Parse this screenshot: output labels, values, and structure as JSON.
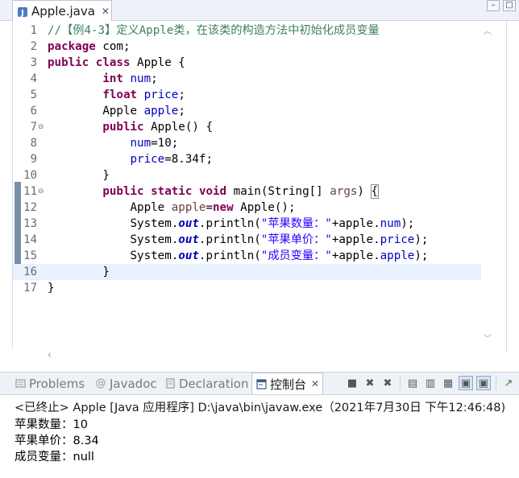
{
  "editor": {
    "tab_label": "Apple.java",
    "close_glyph": "✕",
    "lines": [
      {
        "n": "1",
        "segs": [
          {
            "t": "//【例4-3】定义Apple类，在该类的构造方法中初始化成员变量",
            "c": "cmt"
          }
        ]
      },
      {
        "n": "2",
        "segs": [
          {
            "t": "package",
            "c": "kw"
          },
          {
            "t": " com;"
          }
        ]
      },
      {
        "n": "3",
        "segs": [
          {
            "t": "public",
            "c": "kw"
          },
          {
            "t": " "
          },
          {
            "t": "class",
            "c": "kw"
          },
          {
            "t": " Apple {"
          }
        ]
      },
      {
        "n": "4",
        "segs": [
          {
            "t": "        "
          },
          {
            "t": "int",
            "c": "kw"
          },
          {
            "t": " "
          },
          {
            "t": "num",
            "c": "fld"
          },
          {
            "t": ";"
          }
        ]
      },
      {
        "n": "5",
        "segs": [
          {
            "t": "        "
          },
          {
            "t": "float",
            "c": "kw"
          },
          {
            "t": " "
          },
          {
            "t": "price",
            "c": "fld"
          },
          {
            "t": ";"
          }
        ]
      },
      {
        "n": "6",
        "segs": [
          {
            "t": "        Apple "
          },
          {
            "t": "apple",
            "c": "fld"
          },
          {
            "t": ";"
          }
        ]
      },
      {
        "n": "7",
        "fold": true,
        "segs": [
          {
            "t": "        "
          },
          {
            "t": "public",
            "c": "kw"
          },
          {
            "t": " Apple() {"
          }
        ]
      },
      {
        "n": "8",
        "segs": [
          {
            "t": "            "
          },
          {
            "t": "num",
            "c": "fld"
          },
          {
            "t": "=10;"
          }
        ]
      },
      {
        "n": "9",
        "segs": [
          {
            "t": "            "
          },
          {
            "t": "price",
            "c": "fld"
          },
          {
            "t": "=8.34f;"
          }
        ]
      },
      {
        "n": "10",
        "segs": [
          {
            "t": "        }"
          }
        ]
      },
      {
        "n": "11",
        "fold": true,
        "segs": [
          {
            "t": "        "
          },
          {
            "t": "public",
            "c": "kw"
          },
          {
            "t": " "
          },
          {
            "t": "static",
            "c": "kw"
          },
          {
            "t": " "
          },
          {
            "t": "void",
            "c": "kw"
          },
          {
            "t": " main(String[] "
          },
          {
            "t": "args",
            "c": "var"
          },
          {
            "t": ") "
          },
          {
            "t": "{",
            "c": "brace-hl"
          }
        ]
      },
      {
        "n": "12",
        "segs": [
          {
            "t": "            Apple "
          },
          {
            "t": "apple",
            "c": "var"
          },
          {
            "t": "="
          },
          {
            "t": "new",
            "c": "kw"
          },
          {
            "t": " Apple();"
          }
        ]
      },
      {
        "n": "13",
        "segs": [
          {
            "t": "            System."
          },
          {
            "t": "out",
            "c": "stat"
          },
          {
            "t": ".println("
          },
          {
            "t": "\"苹果数量：\"",
            "c": "str"
          },
          {
            "t": "+apple."
          },
          {
            "t": "num",
            "c": "fld"
          },
          {
            "t": ");"
          }
        ]
      },
      {
        "n": "14",
        "segs": [
          {
            "t": "            System."
          },
          {
            "t": "out",
            "c": "stat"
          },
          {
            "t": ".println("
          },
          {
            "t": "\"苹果单价：\"",
            "c": "str"
          },
          {
            "t": "+apple."
          },
          {
            "t": "price",
            "c": "fld"
          },
          {
            "t": ");"
          }
        ]
      },
      {
        "n": "15",
        "segs": [
          {
            "t": "            System."
          },
          {
            "t": "out",
            "c": "stat"
          },
          {
            "t": ".println("
          },
          {
            "t": "\"成员变量：\"",
            "c": "str"
          },
          {
            "t": "+apple."
          },
          {
            "t": "apple",
            "c": "fld"
          },
          {
            "t": ");"
          }
        ]
      },
      {
        "n": "16",
        "segs": [
          {
            "t": "        }"
          }
        ]
      },
      {
        "n": "17",
        "segs": [
          {
            "t": "}"
          }
        ]
      }
    ]
  },
  "views": {
    "tabs": [
      {
        "label": "Problems",
        "icon": "problems-icon"
      },
      {
        "label": "Javadoc",
        "icon": "javadoc-icon"
      },
      {
        "label": "Declaration",
        "icon": "declaration-icon"
      },
      {
        "label": "控制台",
        "icon": "console-icon",
        "active": true
      }
    ],
    "close_glyph": "✕"
  },
  "console": {
    "header": "<已终止> Apple [Java 应用程序] D:\\java\\bin\\javaw.exe（2021年7月30日 下午12:46:48)",
    "lines": [
      "苹果数量：10",
      "苹果单价：8.34",
      "成员变量：null"
    ]
  },
  "colors": {
    "keyword": "#7f0055",
    "comment": "#3f7f5f",
    "field": "#0000c0",
    "string": "#2a00ff",
    "current_line": "#e8f2fe"
  }
}
